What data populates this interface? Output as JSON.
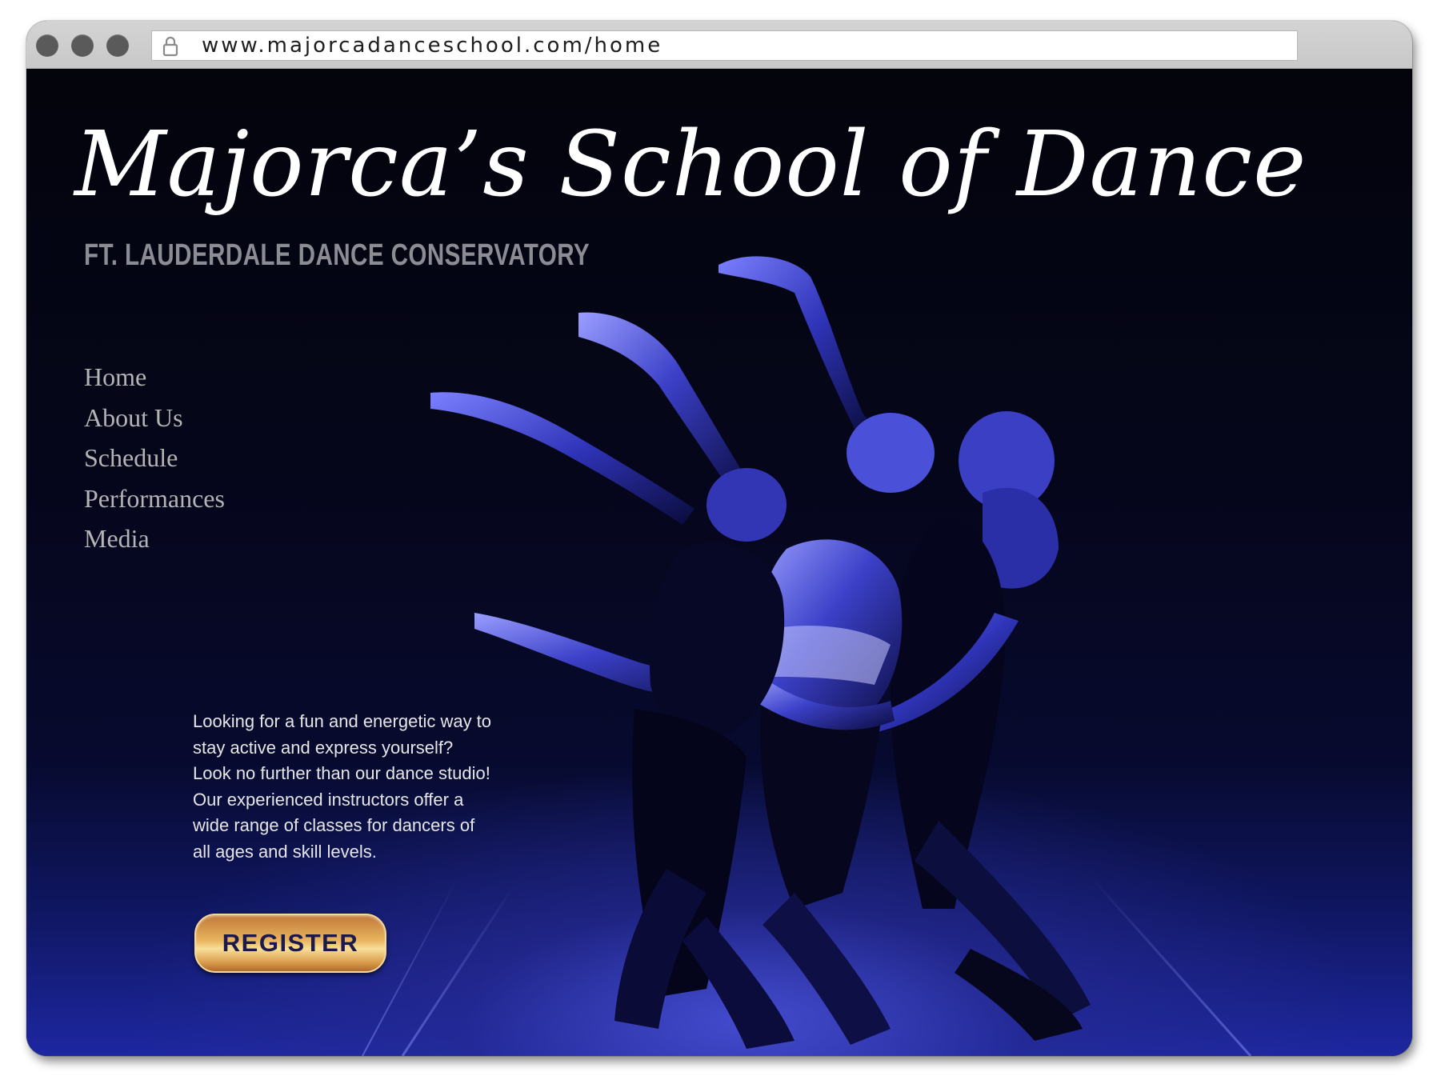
{
  "browser": {
    "url": "www.majorcadanceschool.com/home"
  },
  "site": {
    "title": "Majorca’s School of Dance",
    "subtitle": "FT. LAUDERDALE DANCE CONSERVATORY"
  },
  "nav": {
    "items": [
      "Home",
      "About Us",
      "Schedule",
      "Performances",
      "Media"
    ]
  },
  "hero": {
    "lines": [
      "Looking for a fun and energetic way to",
      "stay active and express yourself?",
      "Look no further than our dance studio!",
      "Our experienced instructors offer a",
      "wide range of classes for dancers of",
      "all ages and skill levels."
    ],
    "register_label": "REGISTER",
    "image": "dancers-photo"
  },
  "icons": {
    "lock": "lock-icon"
  },
  "colors": {
    "background": "#05061a",
    "stage_glow": "#3a46d2",
    "title": "#ffffff",
    "subtitle": "#8c8c94",
    "nav": "#b4b4b4",
    "button_gold": "#e8b45e",
    "button_text": "#1c1a4c"
  }
}
